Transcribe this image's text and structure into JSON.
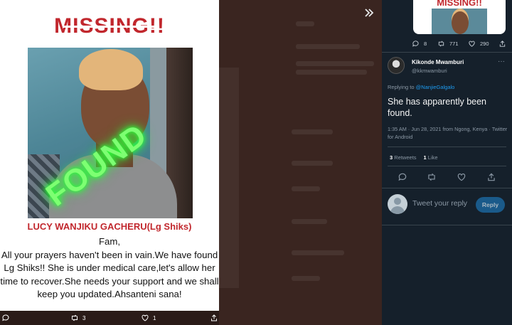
{
  "poster": {
    "headline": "MISSING!!",
    "stamp": "FOUND",
    "name": "LUCY WANJIKU GACHERU(Lg Shiks)",
    "greeting": "Fam,",
    "message": "All your prayers haven't been in vain.We have found Lg Shiks!! She is under medical care,let's allow her time to recover.She needs your support and we shall keep you updated.Ahsanteni sana!"
  },
  "media_actions": {
    "retweets": "3",
    "likes": "1"
  },
  "thread": {
    "thumbnail_headline": "MISSING!!",
    "parent_stats": {
      "replies": "8",
      "retweets": "771",
      "likes": "290"
    },
    "tweet": {
      "author": "Kikonde Mwamburi",
      "handle": "@kkmwamburi",
      "replying_prefix": "Replying to ",
      "replying_to": "@NanjieGalgalo",
      "text": "She has apparently been found.",
      "meta": "1:35 AM · Jun 28, 2021 from Ngong, Kenya · Twitter for Android",
      "retweet_count": "3",
      "retweet_label": "Retweets",
      "like_count": "1",
      "like_label": "Like"
    },
    "reply_placeholder": "Tweet your reply",
    "reply_button": "Reply"
  }
}
